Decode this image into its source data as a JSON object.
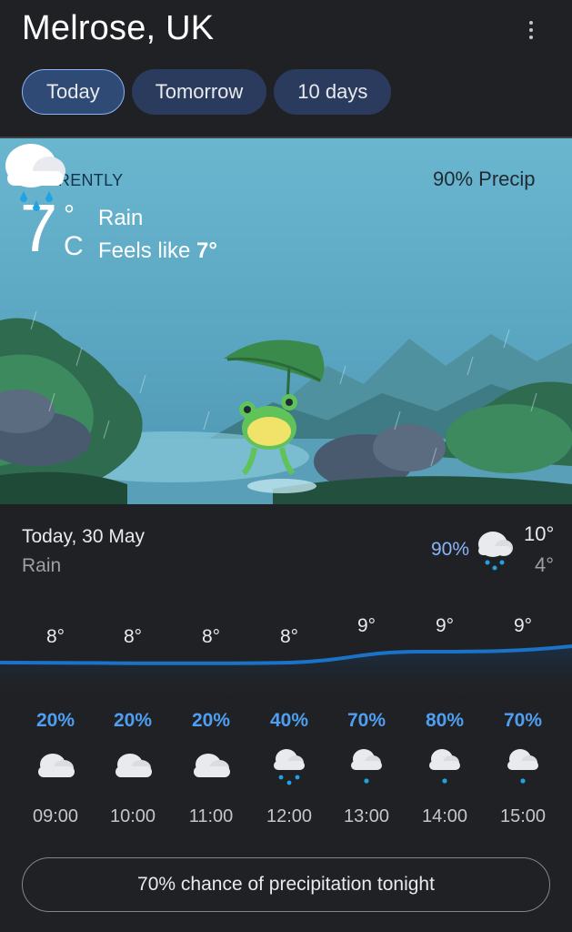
{
  "header": {
    "location": "Melrose, UK",
    "tabs": [
      {
        "label": "Today",
        "active": true
      },
      {
        "label": "Tomorrow",
        "active": false
      },
      {
        "label": "10 days",
        "active": false
      }
    ]
  },
  "current": {
    "label": "CURRENTLY",
    "temp": "7",
    "degree": "°",
    "unit": "C",
    "condition": "Rain",
    "feels_like_prefix": "Feels like",
    "feels_like_value": "7°",
    "precip": "90% Precip",
    "icon": "rain-cloud-icon"
  },
  "summary": {
    "date": "Today, 30 May",
    "condition": "Rain",
    "precip": "90%",
    "high": "10°",
    "low": "4°",
    "icon": "rain-cloud-icon"
  },
  "hourly": [
    {
      "time": "09:00",
      "temp": "8°",
      "precip": "20%",
      "icon": "cloud-icon",
      "rain": false
    },
    {
      "time": "10:00",
      "temp": "8°",
      "precip": "20%",
      "icon": "cloud-icon",
      "rain": false
    },
    {
      "time": "11:00",
      "temp": "8°",
      "precip": "20%",
      "icon": "cloud-icon",
      "rain": false
    },
    {
      "time": "12:00",
      "temp": "8°",
      "precip": "40%",
      "icon": "rain-cloud-icon",
      "rain": true
    },
    {
      "time": "13:00",
      "temp": "9°",
      "precip": "70%",
      "icon": "drizzle-cloud-icon",
      "rain": true
    },
    {
      "time": "14:00",
      "temp": "9°",
      "precip": "80%",
      "icon": "drizzle-cloud-icon",
      "rain": true
    },
    {
      "time": "15:00",
      "temp": "9°",
      "precip": "70%",
      "icon": "drizzle-cloud-icon",
      "rain": true
    }
  ],
  "tonight": "70% chance of precipitation tonight",
  "colors": {
    "background": "#202124",
    "accent_blue": "#4e9ff2",
    "tab_bg": "#2a3b5e",
    "sky": "#6bb6cf"
  }
}
